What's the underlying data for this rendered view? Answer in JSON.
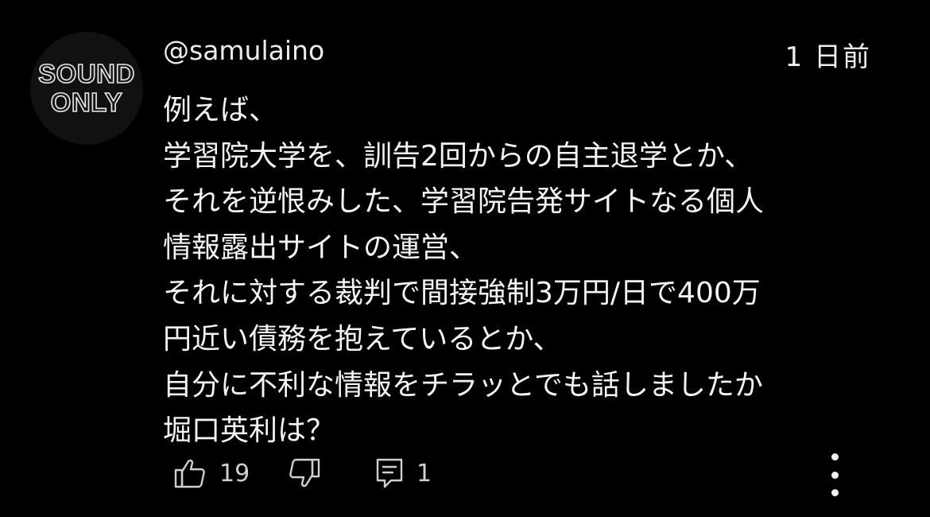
{
  "avatar": {
    "line1": "SOUND",
    "line2": "ONLY"
  },
  "comment": {
    "author": "@samulaino",
    "timestamp": "1 日前",
    "lines": [
      "例えば、",
      "学習院大学を、訓告2回からの自主退学とか、",
      "それを逆恨みした、学習院告発サイトなる個人",
      "情報露出サイトの運営、",
      "それに対する裁判で間接強制3万円/日で400万",
      "円近い債務を抱えているとか、",
      "自分に不利な情報をチラッとでも話しましたか",
      "堀口英利は？"
    ]
  },
  "actions": {
    "like_count": "19",
    "reply_count": "1",
    "icons": {
      "like": "thumbs-up-icon",
      "dislike": "thumbs-down-icon",
      "reply": "comment-icon",
      "more": "more-vertical-icon"
    }
  },
  "colors": {
    "background": "#000000",
    "text": "#f1f1f1",
    "icon": "#cfcfcf"
  }
}
